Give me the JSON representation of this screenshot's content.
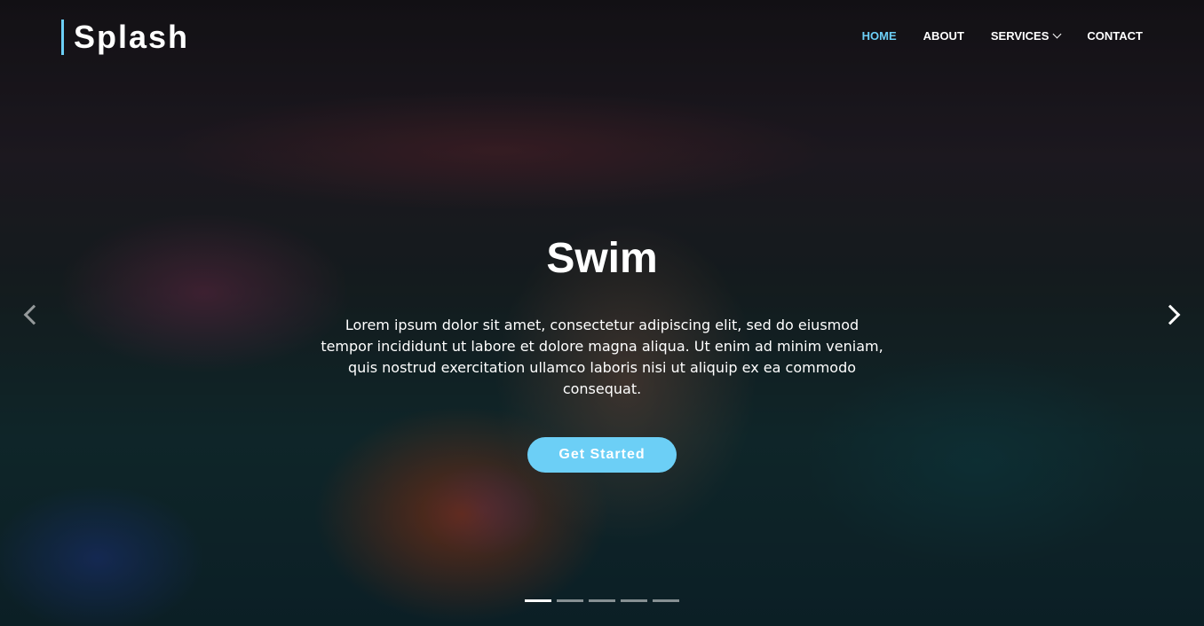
{
  "brand": {
    "name": "Splash"
  },
  "nav": {
    "items": [
      {
        "label": "HOME",
        "active": true
      },
      {
        "label": "ABOUT",
        "active": false
      },
      {
        "label": "SERVICES",
        "active": false,
        "has_dropdown": true
      },
      {
        "label": "CONTACT",
        "active": false
      }
    ]
  },
  "hero": {
    "title": "Swim",
    "description": "Lorem ipsum dolor sit amet, consectetur adipiscing elit, sed do eiusmod tempor incididunt ut labore et dolore magna aliqua. Ut enim ad minim veniam, quis nostrud exercitation ullamco laboris nisi ut aliquip ex ea commodo consequat.",
    "cta_label": "Get Started"
  },
  "carousel": {
    "prev_icon": "chevron-left-icon",
    "next_icon": "chevron-right-icon",
    "indicator_count": 5,
    "active_index": 0
  },
  "colors": {
    "accent": "#6ccff6",
    "text": "#ffffff"
  }
}
